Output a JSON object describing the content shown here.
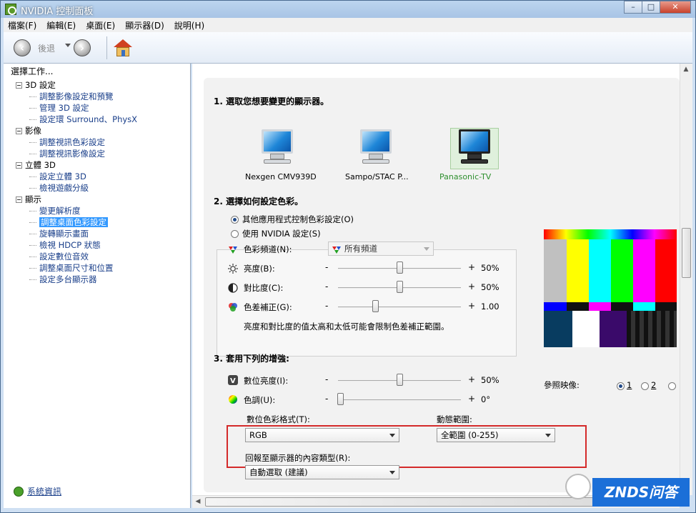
{
  "window": {
    "title": "NVIDIA 控制面板"
  },
  "menu": [
    "檔案(F)",
    "編輯(E)",
    "桌面(E)",
    "顯示器(D)",
    "說明(H)"
  ],
  "toolbar": {
    "back_label": "後退"
  },
  "left": {
    "task_label": "選擇工作...",
    "tree": [
      {
        "label": "3D 設定",
        "type": "cat"
      },
      {
        "label": "調整影像設定和預覽",
        "type": "child"
      },
      {
        "label": "管理 3D 設定",
        "type": "child"
      },
      {
        "label": "設定環 Surround、PhysX",
        "type": "child"
      },
      {
        "label": "影像",
        "type": "cat"
      },
      {
        "label": "調整視訊色彩設定",
        "type": "child"
      },
      {
        "label": "調整視訊影像設定",
        "type": "child"
      },
      {
        "label": "立體 3D",
        "type": "cat"
      },
      {
        "label": "設定立體 3D",
        "type": "child"
      },
      {
        "label": "檢視遊戲分級",
        "type": "child"
      },
      {
        "label": "顯示",
        "type": "cat"
      },
      {
        "label": "變更解析度",
        "type": "child"
      },
      {
        "label": "調整桌面色彩設定",
        "type": "child",
        "selected": true
      },
      {
        "label": "旋轉顯示畫面",
        "type": "child"
      },
      {
        "label": "檢視 HDCP 狀態",
        "type": "child"
      },
      {
        "label": "設定數位音效",
        "type": "child"
      },
      {
        "label": "調整桌面尺寸和位置",
        "type": "child"
      },
      {
        "label": "設定多台顯示器",
        "type": "child"
      }
    ],
    "system_info": "系統資訊"
  },
  "main": {
    "section1": "1. 選取您想要變更的顯示器。",
    "monitors": [
      {
        "name": "Nexgen CMV939D"
      },
      {
        "name": "Sampo/STAC P..."
      },
      {
        "name": "Panasonic-TV"
      }
    ],
    "section2": "2. 選擇如何設定色彩。",
    "radio_other_app": "其他應用程式控制色彩設定(O)",
    "radio_nvidia": "使用 NVIDIA 設定(S)",
    "color_channel_label": "色彩頻道(N):",
    "color_channel_value": "所有頻道",
    "brightness_label": "亮度(B):",
    "brightness_value": "50%",
    "brightness_level": 0.5,
    "contrast_label": "對比度(C):",
    "contrast_value": "50%",
    "contrast_level": 0.5,
    "gamma_label": "色差補正(G):",
    "gamma_value": "1.00",
    "gamma_level": 0.3,
    "note": "亮度和對比度的值太高和太低可能會限制色差補正範圍。",
    "section3": "3. 套用下列的增強:",
    "digital_vibrance_label": "數位亮度(I):",
    "digital_vibrance_value": "50%",
    "digital_vibrance_level": 0.5,
    "hue_label": "色調(U):",
    "hue_value": "0°",
    "hue_level": 0.02,
    "color_format_label": "數位色彩格式(T):",
    "color_format_value": "RGB",
    "dynamic_range_label": "動態範圍:",
    "dynamic_range_value": "全範圍 (0-255)",
    "content_type_label": "回報至顯示器的內容類型(R):",
    "content_type_value": "自動選取 (建議)",
    "ref_label": "參照映像:",
    "ref_options": [
      "1",
      "2"
    ],
    "minus": "-",
    "plus": "+"
  },
  "watermark": "ZNDS问答",
  "colors": {
    "accent": "#3399ff",
    "highlight_box": "#d42a2a"
  }
}
